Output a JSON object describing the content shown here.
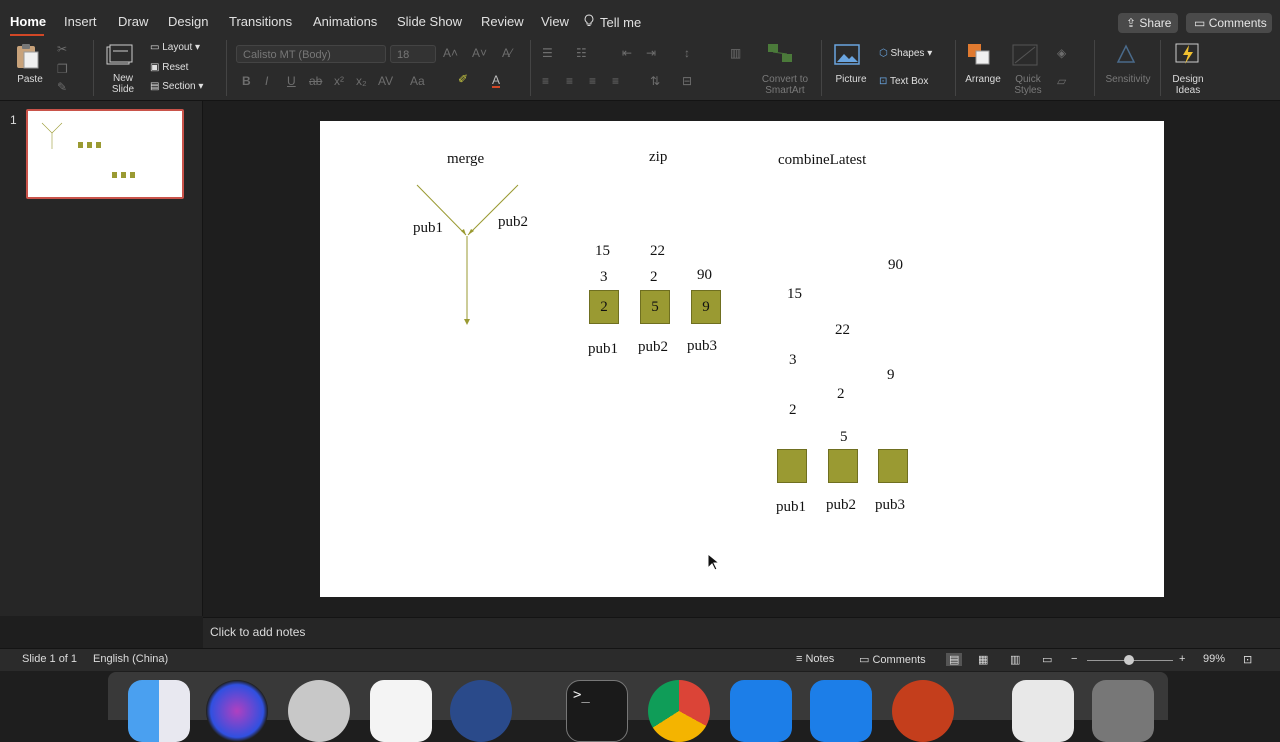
{
  "tabs": [
    "Home",
    "Insert",
    "Draw",
    "Design",
    "Transitions",
    "Animations",
    "Slide Show",
    "Review",
    "View"
  ],
  "tell_me": "Tell me",
  "share_label": "Share",
  "comments_label": "Comments",
  "ribbon": {
    "paste": "Paste",
    "new_slide": "New\nSlide",
    "layout": "Layout",
    "reset": "Reset",
    "section": "Section",
    "font_name": "Calisto MT (Body)",
    "font_size": "18",
    "convert_smartart": "Convert to\nSmartArt",
    "picture": "Picture",
    "shapes": "Shapes",
    "text_box": "Text Box",
    "arrange": "Arrange",
    "quick_styles": "Quick\nStyles",
    "sensitivity": "Sensitivity",
    "design_ideas": "Design\nIdeas"
  },
  "thumbnail_number": "1",
  "slide": {
    "merge_title": "merge",
    "zip_title": "zip",
    "combine_title": "combineLatest",
    "merge_pub1": "pub1",
    "merge_pub2": "pub2",
    "zip_vals": [
      "15",
      "22",
      "3",
      "2",
      "90"
    ],
    "zip_boxes": [
      "2",
      "5",
      "9"
    ],
    "zip_labels": [
      "pub1",
      "pub2",
      "pub3"
    ],
    "cl_vals": [
      "90",
      "15",
      "22",
      "3",
      "9",
      "2",
      "2",
      "5"
    ],
    "cl_labels": [
      "pub1",
      "pub2",
      "pub3"
    ]
  },
  "notes_placeholder": "Click to add notes",
  "status": {
    "slide_info": "Slide 1 of 1",
    "language": "English (China)",
    "notes": "Notes",
    "comments": "Comments",
    "zoom": "99%"
  },
  "colors": {
    "accent": "#d24726",
    "box_fill": "#9a9a32",
    "arrow": "#9a9a32"
  }
}
